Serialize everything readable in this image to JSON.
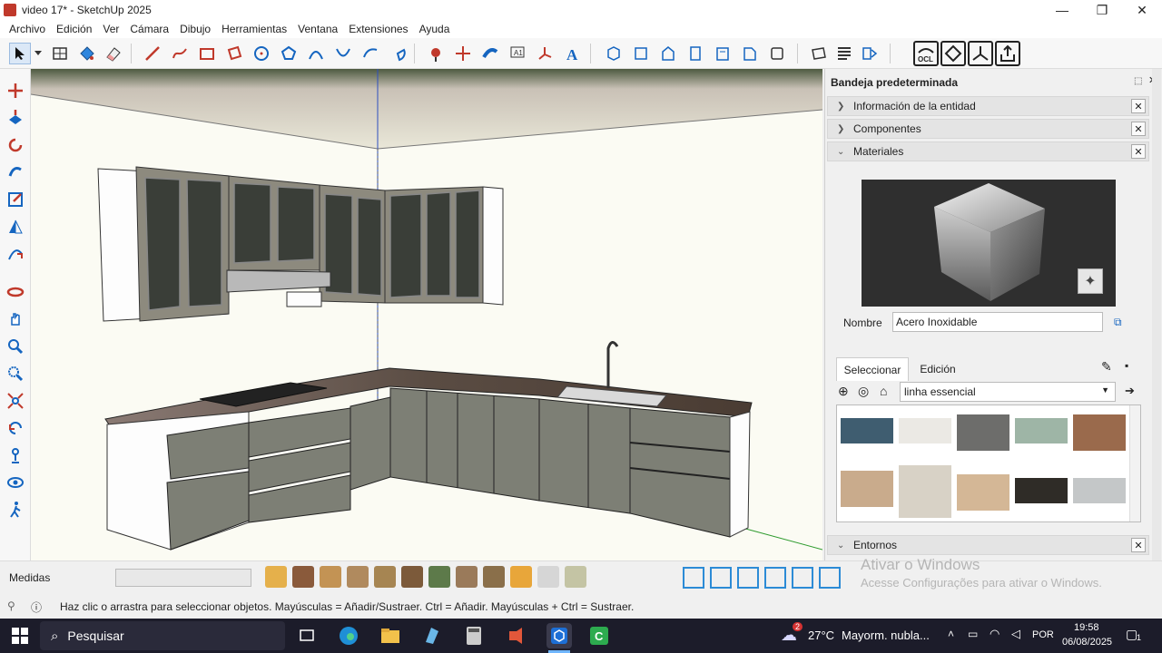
{
  "window": {
    "title": "video 17* - SketchUp 2025",
    "minimize": "—",
    "maximize": "❐",
    "close": "✕"
  },
  "menu": [
    "Archivo",
    "Edición",
    "Ver",
    "Cámara",
    "Dibujo",
    "Herramientas",
    "Ventana",
    "Extensiones",
    "Ayuda"
  ],
  "tray": {
    "title": "Bandeja predeterminada",
    "sections": {
      "entity_info": "Información de la entidad",
      "components": "Componentes",
      "materials": "Materiales",
      "environments": "Entornos"
    },
    "materials": {
      "name_label": "Nombre",
      "name_value": "Acero Inoxidable",
      "tab_select": "Seleccionar",
      "tab_edit": "Edición",
      "library": "linha essencial",
      "swatches": [
        "#3f5d70",
        "#ebe9e4",
        "#6d6d6b",
        "#9eb5a6",
        "#9a6a4c",
        "#c9ab8c",
        "#d8d2c6",
        "#d4b796",
        "#2f2c27",
        "#c4c7c8"
      ]
    }
  },
  "status": {
    "measurements_label": "Medidas",
    "measurements_value": "",
    "hint": "Haz clic o arrastra para seleccionar objetos. Mayúsculas = Añadir/Sustraer. Ctrl = Añadir. Mayúsculas + Ctrl = Sustraer.",
    "watermark_title": "Ativar o Windows",
    "watermark_sub": "Acesse Configurações para ativar o Windows."
  },
  "taskbar": {
    "search": "Pesquisar",
    "weather_temp": "27°C",
    "weather_text": "Mayorm. nubla...",
    "weather_badge": "2",
    "lang": "POR",
    "time": "19:58",
    "date": "06/08/2025",
    "notif_count": "1"
  },
  "colors": {
    "viewport_bg": "#fbfbf3",
    "cabinet": "#7d7f75",
    "accent_blue": "#1565c0",
    "taskbar_bg": "#1c1c2a"
  }
}
